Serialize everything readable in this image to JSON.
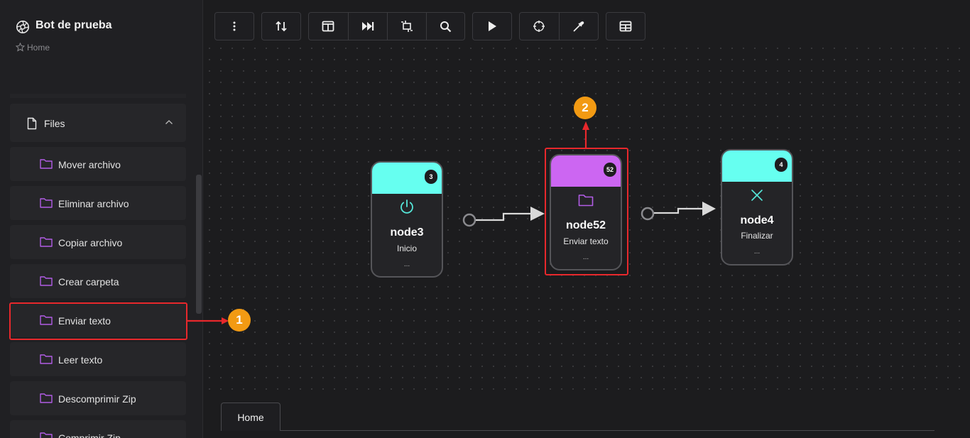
{
  "app": {
    "title": "Bot de prueba",
    "breadcrumb": "Home"
  },
  "sidebar": {
    "section_label": "Files",
    "items": [
      {
        "label": "Mover archivo"
      },
      {
        "label": "Eliminar archivo"
      },
      {
        "label": "Copiar archivo"
      },
      {
        "label": "Crear carpeta"
      },
      {
        "label": "Enviar texto"
      },
      {
        "label": "Leer texto"
      },
      {
        "label": "Descomprimir Zip"
      },
      {
        "label": "Comprimir Zip"
      }
    ]
  },
  "toolbar": {
    "buttons": [
      "more-vertical-icon",
      "sort-icon",
      "layout-columns-icon",
      "skip-forward-icon",
      "fit-view-icon",
      "search-icon",
      "play-icon",
      "crosshair-icon",
      "eyedropper-icon",
      "table-icon"
    ]
  },
  "nodes": [
    {
      "id": "node3",
      "badge": "3",
      "name": "node3",
      "subtitle": "Inicio",
      "dots": "...",
      "head_color": "#66fff0",
      "icon": "power-icon"
    },
    {
      "id": "node52",
      "badge": "52",
      "name": "node52",
      "subtitle": "Enviar texto",
      "dots": "...",
      "head_color": "#cc66f2",
      "icon": "folder-icon"
    },
    {
      "id": "node4",
      "badge": "4",
      "name": "node4",
      "subtitle": "Finalizar",
      "dots": "...",
      "head_color": "#66fff0",
      "icon": "close-icon"
    }
  ],
  "annotations": {
    "step1": "1",
    "step2": "2",
    "highlight_color": "#e8282c",
    "step_color": "#f29a13"
  },
  "tabs": [
    {
      "label": "Home"
    }
  ]
}
